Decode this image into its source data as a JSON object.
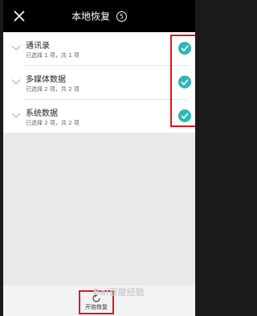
{
  "header": {
    "title": "本地恢复",
    "badge": "5",
    "close_icon": "close-icon"
  },
  "items": [
    {
      "title": "通讯录",
      "subtitle": "已选择 1 项，共 1 项",
      "checked": true
    },
    {
      "title": "多媒体数据",
      "subtitle": "已选择 2 项，共 2 项",
      "checked": true
    },
    {
      "title": "系统数据",
      "subtitle": "已选择 2 项，共 2 项",
      "checked": true
    }
  ],
  "bottom": {
    "restore_label": "开始恢复",
    "restore_icon": "restore-icon"
  },
  "watermark": "Bai百度经验",
  "colors": {
    "header_bg": "#000000",
    "check": "#2fb6b6",
    "highlight": "#e3141d",
    "page_bg": "#e9e9e9"
  }
}
